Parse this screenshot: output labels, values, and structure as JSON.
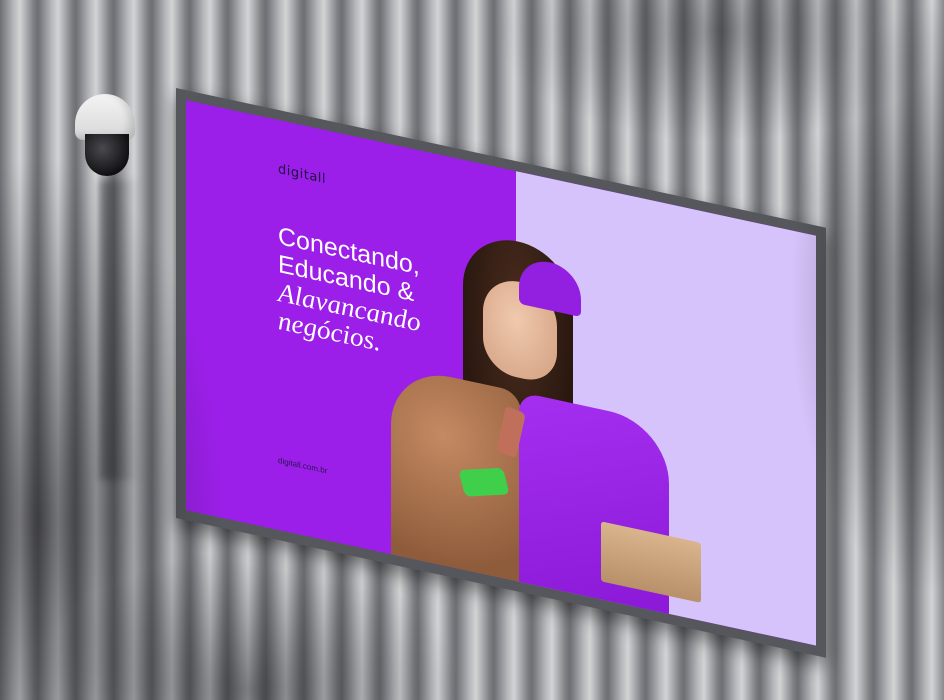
{
  "billboard": {
    "logo": "digitall",
    "headline_lines": [
      "Conectando,",
      "Educando &"
    ],
    "headline_italic_lines": [
      "Alavancando",
      "negócios."
    ],
    "url": "digitall.com.br"
  },
  "colors": {
    "ad_purple": "#9b1fe8",
    "ad_lavender": "#d6c3fb",
    "wall_gray": "#9a9ba0"
  }
}
